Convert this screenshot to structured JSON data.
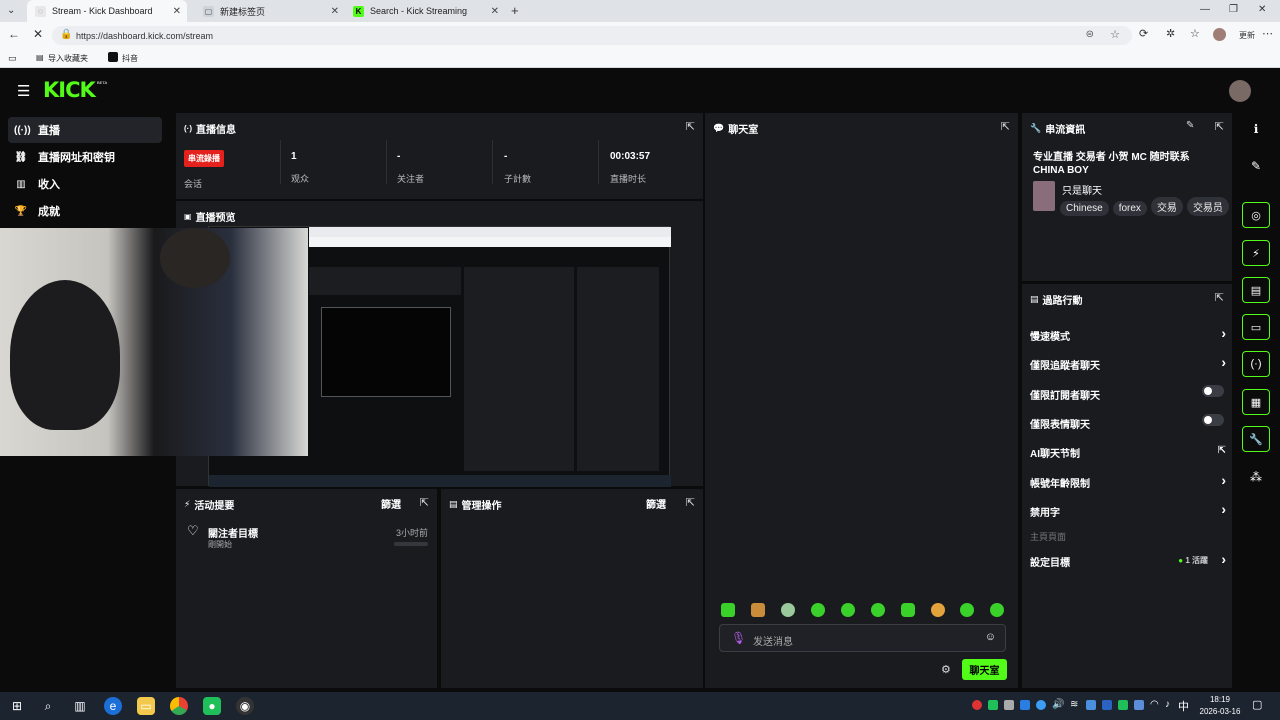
{
  "browser": {
    "tabs": [
      {
        "title": "Stream - Kick Dashboard",
        "active": true
      },
      {
        "title": "新建标签页",
        "active": false
      },
      {
        "title": "Search - Kick Streaming",
        "active": false
      }
    ],
    "url": "https://dashboard.kick.com/stream",
    "bookmarks": [
      "导入收藏夹",
      "抖音"
    ],
    "profile_label": "更新"
  },
  "app": {
    "logo": "KICK",
    "logo_badge": "BETA",
    "accent": "#53fc18",
    "sidebar": [
      {
        "label": "直播",
        "icon": "broadcast-icon",
        "active": true
      },
      {
        "label": "直播网址和密钥",
        "icon": "link-icon",
        "active": false
      },
      {
        "label": "收入",
        "icon": "chart-icon",
        "active": false
      },
      {
        "label": "成就",
        "icon": "trophy-icon",
        "active": false
      }
    ],
    "stream_info": {
      "title": "直播信息",
      "session_badge": "串流錄播",
      "session_label": "会话",
      "viewers_value": "1",
      "viewers_label": "观众",
      "followers_value": "-",
      "followers_label": "关注者",
      "subs_value": "-",
      "subs_label": "子計數",
      "duration_value": "00:03:57",
      "duration_label": "直播时长"
    },
    "preview": {
      "title": "直播预览"
    },
    "activity": {
      "title": "活动提要",
      "filter": "篩選",
      "items": [
        {
          "title": "關注者目標",
          "sub": "剛開始",
          "time": "3小时前"
        }
      ]
    },
    "mod_actions": {
      "title": "管理操作",
      "filter": "篩選"
    },
    "chat": {
      "title": "聊天室",
      "placeholder": "发送消息",
      "send_label": "聊天室"
    },
    "stream_meta": {
      "title": "串流資訊",
      "stream_title": "专业直播 交易者 小贺 MC 随时联系 CHINA BOY",
      "category": "只是聊天",
      "tags": [
        "Chinese",
        "forex",
        "交易",
        "交易员"
      ]
    },
    "quick_actions": {
      "title": "過路行動",
      "rows": [
        {
          "label": "慢速模式",
          "control": "chevron"
        },
        {
          "label": "僅限追蹤者聊天",
          "control": "chevron"
        },
        {
          "label": "僅限訂閱者聊天",
          "control": "toggle"
        },
        {
          "label": "僅限表情聊天",
          "control": "toggle"
        },
        {
          "label": "AI聊天节制",
          "control": "external"
        },
        {
          "label": "帳號年齡限制",
          "control": "chevron"
        },
        {
          "label": "禁用字",
          "control": "chevron"
        }
      ],
      "section_label": "主頁頁面",
      "goal_label": "設定目標",
      "goal_status": "1 活躍"
    }
  },
  "taskbar": {
    "clock_time": "18:19",
    "clock_date": "2026-03-16",
    "ime": "中"
  }
}
